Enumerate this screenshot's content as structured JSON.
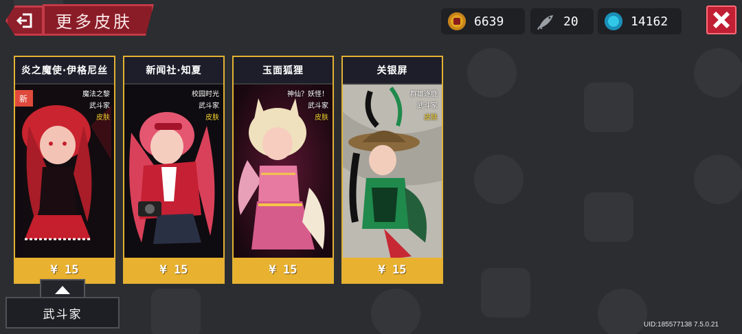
{
  "header": {
    "title": "更多皮肤",
    "back_icon": "exit-icon",
    "close_icon": "close-icon"
  },
  "currencies": [
    {
      "icon": "coin-icon",
      "value": "6639"
    },
    {
      "icon": "fish-icon",
      "value": "20"
    },
    {
      "icon": "gem-icon",
      "value": "14162"
    }
  ],
  "cards": [
    {
      "title": "炎之魔使·伊格尼丝",
      "tags": [
        "魔法之黎",
        "武斗家",
        "皮肤"
      ],
      "price": "¥ 15",
      "badge": "新",
      "colors": {
        "bg": "#120c10",
        "accent": "#d62b3a"
      }
    },
    {
      "title": "新闻社·知夏",
      "tags": [
        "校园时光",
        "武斗家",
        "皮肤"
      ],
      "price": "¥ 15",
      "colors": {
        "bg": "#0e0c10",
        "accent": "#c8263a"
      }
    },
    {
      "title": "玉面狐狸",
      "tags": [
        "神仙？妖怪！",
        "武斗家",
        "皮肤"
      ],
      "price": "¥ 15",
      "colors": {
        "bg": "#2a0d1a",
        "accent": "#e98bb6"
      }
    },
    {
      "title": "关银屏",
      "tags": [
        "群雄逐鹿",
        "武斗家",
        "皮肤"
      ],
      "price": "¥ 15",
      "colors": {
        "bg": "#bdbab2",
        "accent": "#1f8a4c"
      }
    }
  ],
  "filter": {
    "label": "武斗家"
  },
  "footer": {
    "uid": "UID:185577138 7.5.0.21"
  }
}
